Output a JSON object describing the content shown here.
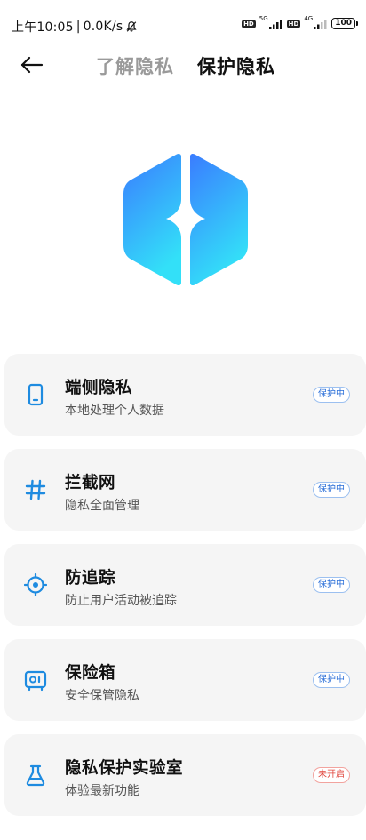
{
  "status_bar": {
    "time": "上午10:05",
    "separator": "|",
    "net_speed": "0.0K/s",
    "hd1": "HD",
    "net1": "5G",
    "hd2": "HD",
    "net2": "4G",
    "battery": "100"
  },
  "header": {
    "tabs": [
      {
        "label": "了解隐私",
        "active": false
      },
      {
        "label": "保护隐私",
        "active": true
      }
    ]
  },
  "colors": {
    "accent": "#1e8be0",
    "logo_gradient_top": "#3a86ff",
    "logo_gradient_bottom": "#33ddf7",
    "badge_on": "#2b6fd8",
    "badge_off": "#e0453c"
  },
  "cards": [
    {
      "title": "端侧隐私",
      "subtitle": "本地处理个人数据",
      "badge": "保护中",
      "icon": "phone-icon",
      "status": "on"
    },
    {
      "title": "拦截网",
      "subtitle": "隐私全面管理",
      "badge": "保护中",
      "icon": "hash-icon",
      "status": "on"
    },
    {
      "title": "防追踪",
      "subtitle": "防止用户活动被追踪",
      "badge": "保护中",
      "icon": "crosshair-icon",
      "status": "on"
    },
    {
      "title": "保险箱",
      "subtitle": "安全保管隐私",
      "badge": "保护中",
      "icon": "safe-icon",
      "status": "on"
    },
    {
      "title": "隐私保护实验室",
      "subtitle": "体验最新功能",
      "badge": "未开启",
      "icon": "flask-icon",
      "status": "off"
    }
  ]
}
